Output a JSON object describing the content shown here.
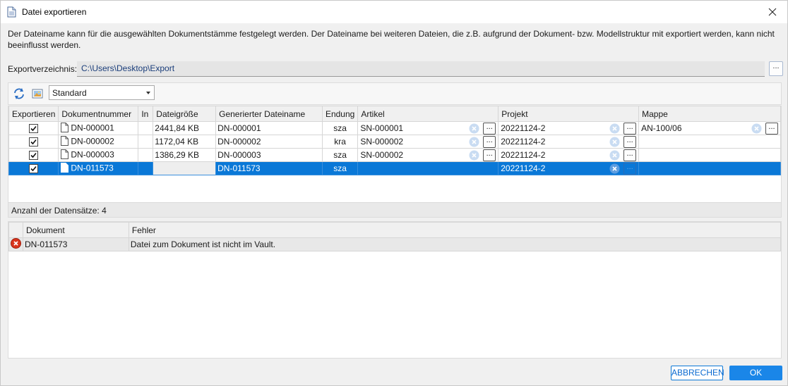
{
  "window": {
    "title": "Datei exportieren"
  },
  "description": "Der Dateiname kann für die ausgewählten Dokumentstämme festgelegt werden. Der Dateiname bei weiteren Dateien, die z.B. aufgrund der Dokument- bzw. Modellstruktur mit exportiert werden, kann nicht beeinflusst werden.",
  "export": {
    "label": "Exportverzeichnis:",
    "path": "C:\\Users\\Desktop\\Export",
    "browse_label": "..."
  },
  "toolbar": {
    "view_selected": "Standard"
  },
  "grid": {
    "columns": [
      "Exportieren",
      "Dokumentnummer",
      "In",
      "Dateigröße",
      "Generierter Dateiname",
      "Endung",
      "Artikel",
      "Projekt",
      "Mappe"
    ],
    "rows": [
      {
        "export": true,
        "docnr": "DN-000001",
        "in": "",
        "size": "2441,84 KB",
        "filename": "DN-000001",
        "ext": "sza",
        "artikel": "SN-000001",
        "projekt": "20221124-2",
        "mappe": "AN-100/06",
        "selected": false
      },
      {
        "export": true,
        "docnr": "DN-000002",
        "in": "",
        "size": "1172,04 KB",
        "filename": "DN-000002",
        "ext": "kra",
        "artikel": "SN-000002",
        "projekt": "20221124-2",
        "mappe": "",
        "selected": false
      },
      {
        "export": true,
        "docnr": "DN-000003",
        "in": "",
        "size": "1386,29 KB",
        "filename": "DN-000003",
        "ext": "sza",
        "artikel": "SN-000002",
        "projekt": "20221124-2",
        "mappe": "",
        "selected": false
      },
      {
        "export": true,
        "docnr": "DN-011573",
        "in": "",
        "size": "",
        "filename": "DN-011573",
        "ext": "sza",
        "artikel": "",
        "projekt": "20221124-2",
        "mappe": "",
        "selected": true
      }
    ],
    "dots_label": "..."
  },
  "count": {
    "text": "Anzahl der Datensätze: 4"
  },
  "errors": {
    "columns": [
      "Dokument",
      "Fehler"
    ],
    "rows": [
      {
        "document": "DN-011573",
        "message": "Datei zum Dokument ist nicht im Vault."
      }
    ]
  },
  "buttons": {
    "cancel": "ABBRECHEN",
    "ok": "OK"
  },
  "colors": {
    "accent": "#0a78d7",
    "error": "#d9341c"
  },
  "icons": {
    "app": "document-icon",
    "close": "close-icon",
    "refresh": "refresh-icon",
    "view": "image-view-icon",
    "clear": "clear-circle-icon",
    "error": "error-circle-icon"
  }
}
